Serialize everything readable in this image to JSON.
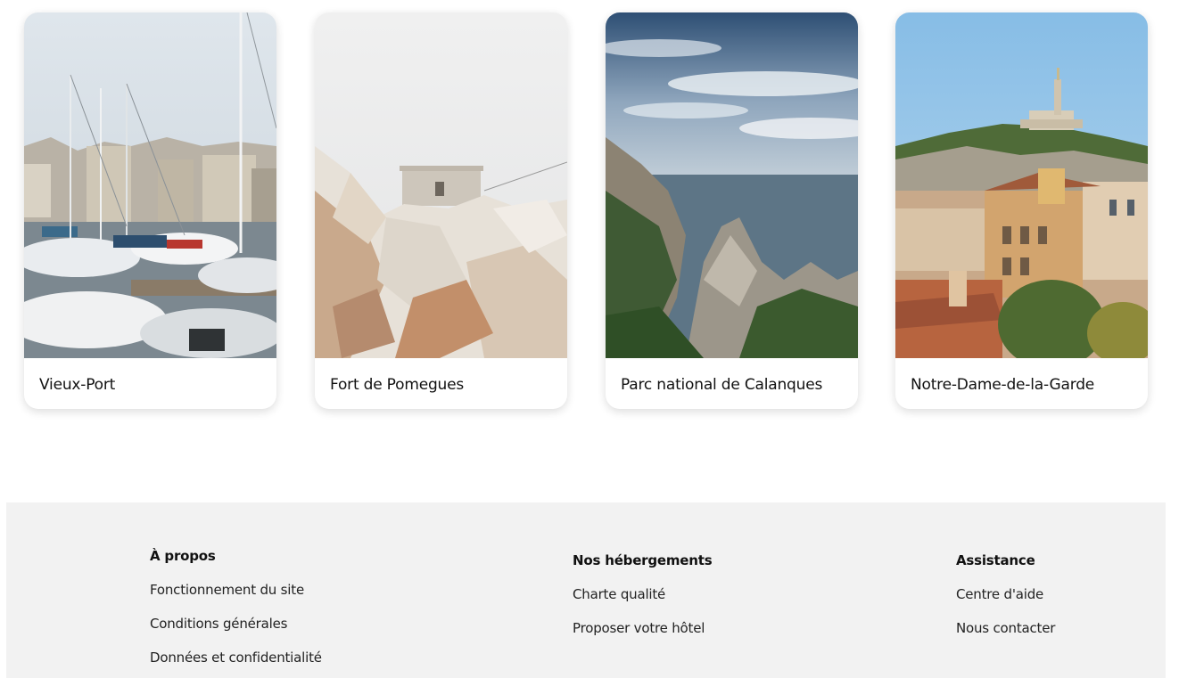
{
  "destinations": [
    {
      "title": "Vieux-Port"
    },
    {
      "title": "Fort de Pomegues"
    },
    {
      "title": "Parc national de Calanques"
    },
    {
      "title": "Notre-Dame-de-la-Garde"
    }
  ],
  "footer": {
    "about": {
      "heading": "À propos",
      "links": [
        "Fonctionnement du site",
        "Conditions générales",
        "Données et confidentialité"
      ]
    },
    "accommodations": {
      "heading": "Nos hébergements",
      "links": [
        "Charte qualité",
        "Proposer votre hôtel"
      ]
    },
    "support": {
      "heading": "Assistance",
      "links": [
        "Centre d'aide",
        "Nous contacter"
      ]
    }
  }
}
